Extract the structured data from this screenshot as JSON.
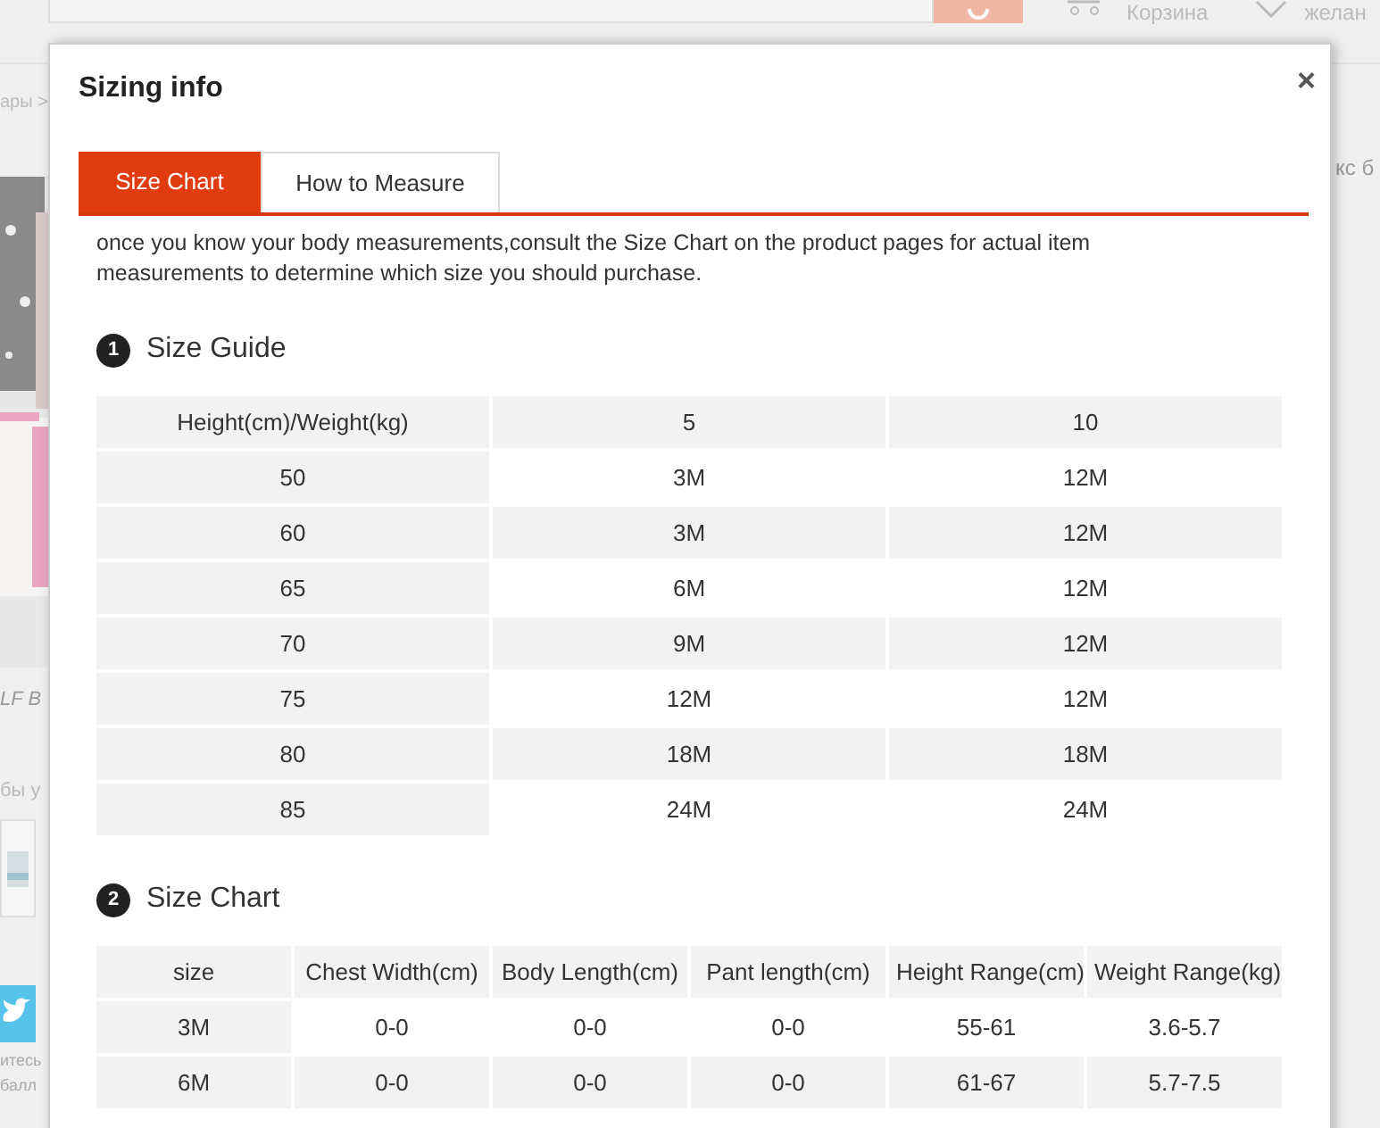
{
  "background_page": {
    "cart_label": "Корзина",
    "wishlist_label": "желан",
    "breadcrumb": "ары >",
    "side_text": "кс б",
    "product_title": "LF B",
    "note": "бы у",
    "social_text_1": "итесь",
    "social_text_2": "балл"
  },
  "dialog": {
    "title": "Sizing info",
    "close": "×",
    "tabs": [
      {
        "label": "Size Chart",
        "selected": true
      },
      {
        "label": "How to Measure",
        "selected": false
      }
    ],
    "intro": "once you know your body measurements,consult the Size Chart on the product pages for actual item measurements to determine which size you should purchase.",
    "sections": [
      {
        "number": "1",
        "title": "Size Guide",
        "table": {
          "columns": [
            "Height(cm)/Weight(kg)",
            "5",
            "10"
          ],
          "rows": [
            [
              "50",
              "3M",
              "12M"
            ],
            [
              "60",
              "3M",
              "12M"
            ],
            [
              "65",
              "6M",
              "12M"
            ],
            [
              "70",
              "9M",
              "12M"
            ],
            [
              "75",
              "12M",
              "12M"
            ],
            [
              "80",
              "18M",
              "18M"
            ],
            [
              "85",
              "24M",
              "24M"
            ]
          ]
        }
      },
      {
        "number": "2",
        "title": "Size Chart",
        "table": {
          "columns": [
            "size",
            "Chest Width(cm)",
            "Body Length(cm)",
            "Pant length(cm)",
            "Height Range(cm)",
            "Weight Range(kg)"
          ],
          "rows": [
            [
              "3M",
              "0-0",
              "0-0",
              "0-0",
              "55-61",
              "3.6-5.7"
            ],
            [
              "6M",
              "0-0",
              "0-0",
              "0-0",
              "61-67",
              "5.7-7.5"
            ]
          ]
        }
      }
    ]
  }
}
